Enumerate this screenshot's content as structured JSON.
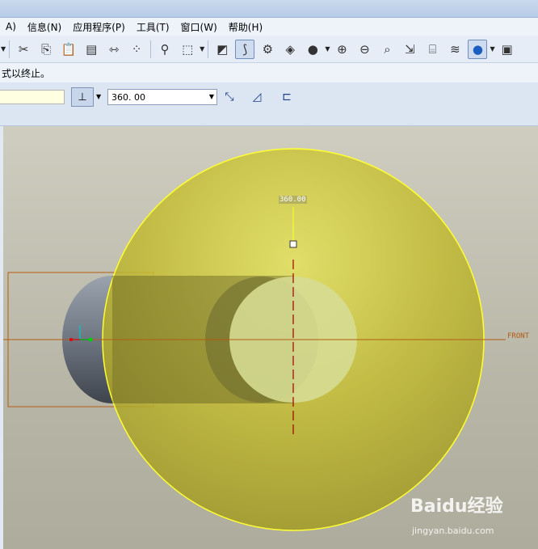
{
  "menu": {
    "items": [
      "A)",
      "信息(N)",
      "应用程序(P)",
      "工具(T)",
      "窗口(W)",
      "帮助(H)"
    ]
  },
  "toolbar": {
    "icons": [
      "scissors-icon",
      "copy-icon",
      "paste-icon",
      "paste-special-icon",
      "mirror-icon",
      "pattern-icon",
      "find-icon",
      "select-box-icon",
      "datum-display-icon",
      "spin-center-icon",
      "saved-view-icon",
      "appearance-icon",
      "zoom-in-icon",
      "zoom-out-icon",
      "refit-icon",
      "reorient-icon",
      "annotation-icon",
      "layer-icon",
      "shade-icon",
      "screenshot-icon"
    ]
  },
  "message": {
    "text": "式以终止。"
  },
  "dashboard": {
    "angle_value": "360. 00",
    "flip_icon": "flip-direction-icon",
    "surface_icon": "surface-icon",
    "sketch_icon": "sketch-icon"
  },
  "viewport": {
    "datum_label": "FRONT",
    "dimension_label": "360.00",
    "colors": {
      "sphere": "#c9c33c",
      "sphere_edge": "#ffff33",
      "datum": "#b55c12",
      "axis": "#a00000",
      "cylinder": "#8a93a0"
    }
  },
  "watermark": {
    "logo": "Baidu经验",
    "url": "jingyan.baidu.com"
  }
}
